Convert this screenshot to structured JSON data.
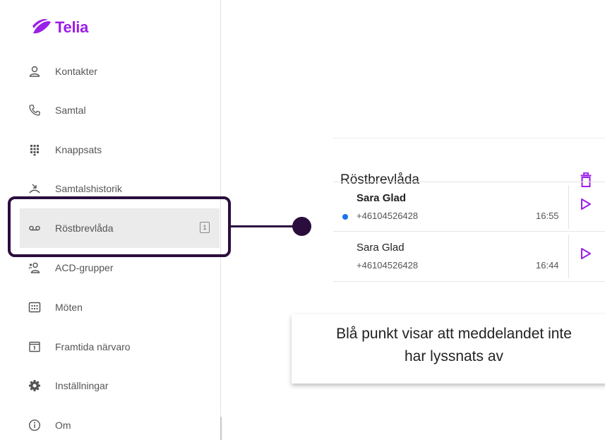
{
  "brand": {
    "name": "Telia",
    "color": "#9b1fe8"
  },
  "sidebar": {
    "items": [
      {
        "label": "Kontakter",
        "icon": "person-icon"
      },
      {
        "label": "Samtal",
        "icon": "phone-icon"
      },
      {
        "label": "Knappsats",
        "icon": "dialpad-icon"
      },
      {
        "label": "Samtalshistorik",
        "icon": "call-history-icon"
      },
      {
        "label": "Röstbrevlåda",
        "icon": "voicemail-icon",
        "badge": "1",
        "active": true
      },
      {
        "label": "ACD-grupper",
        "icon": "group-icon"
      },
      {
        "label": "Möten",
        "icon": "meeting-icon"
      },
      {
        "label": "Framtida närvaro",
        "icon": "calendar-icon"
      },
      {
        "label": "Inställningar",
        "icon": "gear-icon"
      },
      {
        "label": "Om",
        "icon": "info-icon"
      }
    ]
  },
  "voicemail": {
    "title": "Röstbrevlåda",
    "messages": [
      {
        "name": "Sara Glad",
        "number": "+46104526428",
        "time": "16:55",
        "unread": true
      },
      {
        "name": "Sara Glad",
        "number": "+46104526428",
        "time": "16:44",
        "unread": false
      }
    ]
  },
  "callout": {
    "line1": "Blå punkt visar att meddelandet inte",
    "line2": "har lyssnats av"
  },
  "colors": {
    "accent": "#9b1fe8",
    "unread_dot": "#1a73e8",
    "annotation": "#2b0d3d",
    "active_bg": "#ebebeb"
  }
}
